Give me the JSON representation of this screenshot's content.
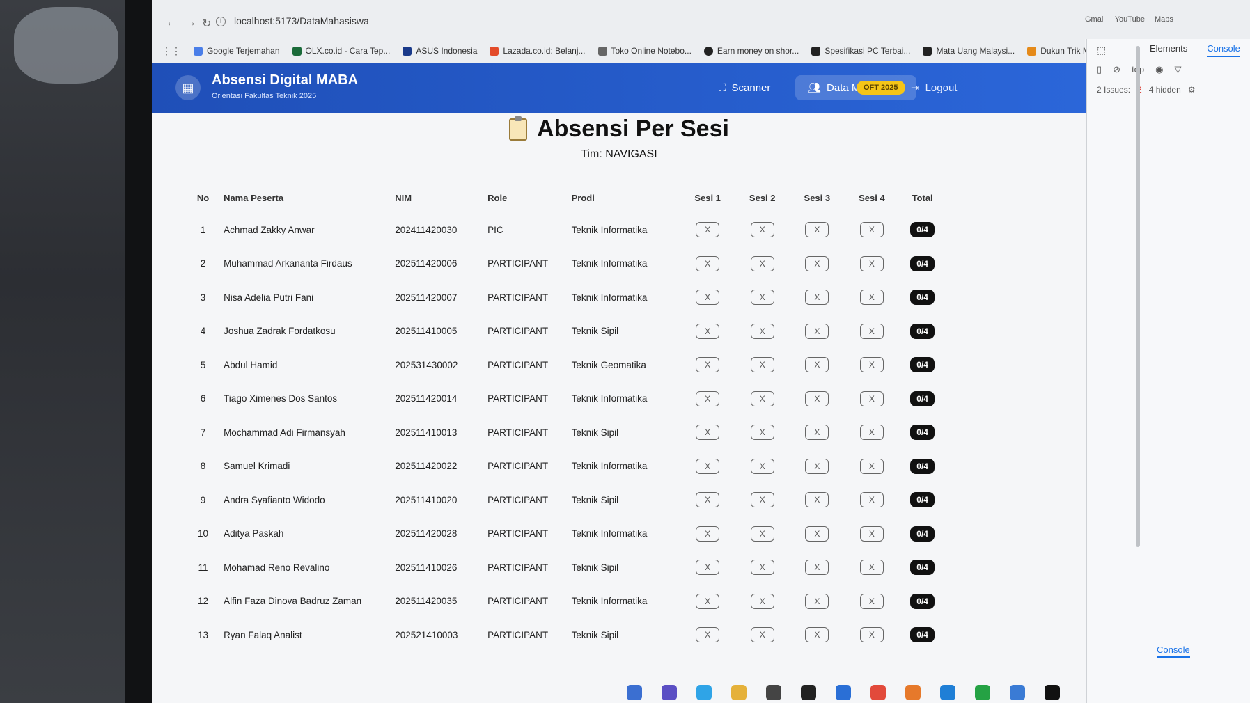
{
  "browser": {
    "url": "localhost:5173/DataMahasiswa",
    "bookmarks": [
      {
        "label": "Google Terjemahan",
        "color": "#4a7ee8"
      },
      {
        "label": "OLX.co.id - Cara Tep...",
        "color": "#1b6b3a"
      },
      {
        "label": "ASUS Indonesia",
        "color": "#1a3a8a"
      },
      {
        "label": "Lazada.co.id: Belanj...",
        "color": "#e34b2a"
      },
      {
        "label": "Toko Online Notebo...",
        "color": "#666666"
      },
      {
        "label": "Earn money on shor...",
        "color": "#222222"
      },
      {
        "label": "Spesifikasi PC Terbai...",
        "color": "#222222"
      },
      {
        "label": "Mata Uang Malaysi...",
        "color": "#222222"
      },
      {
        "label": "Dukun Trik Modern...",
        "color": "#e58a1a"
      }
    ],
    "bookmarks_right": [
      "Gmail",
      "YouTube",
      "Maps"
    ]
  },
  "devtools": {
    "tabs": [
      "Elements",
      "Console"
    ],
    "context": "top",
    "issues_label": "2 Issues:",
    "issues_count": "2",
    "hidden_label": "4 hidden",
    "bottom_tab": "Console"
  },
  "app": {
    "brand_title": "Absensi Digital MABA",
    "brand_subtitle": "Orientasi Fakultas Teknik 2025",
    "nav": {
      "scanner": "Scanner",
      "data_mahasiswa": "Data Mahasiswa",
      "badge": "OFT 2025",
      "logout": "Logout"
    },
    "page_title": "Absensi Per Sesi",
    "team_label": "Tim:",
    "team_name": "NAVIGASI",
    "columns": {
      "no": "No",
      "name": "Nama Peserta",
      "nim": "NIM",
      "role": "Role",
      "prodi": "Prodi",
      "s1": "Sesi 1",
      "s2": "Sesi 2",
      "s3": "Sesi 3",
      "s4": "Sesi 4",
      "total": "Total"
    },
    "mark": "X",
    "rows": [
      {
        "no": "1",
        "name": "Achmad Zakky Anwar",
        "nim": "202411420030",
        "role": "PIC",
        "prodi": "Teknik Informatika",
        "total": "0/4"
      },
      {
        "no": "2",
        "name": "Muhammad Arkananta Firdaus",
        "nim": "202511420006",
        "role": "PARTICIPANT",
        "prodi": "Teknik Informatika",
        "total": "0/4"
      },
      {
        "no": "3",
        "name": "Nisa Adelia Putri Fani",
        "nim": "202511420007",
        "role": "PARTICIPANT",
        "prodi": "Teknik Informatika",
        "total": "0/4"
      },
      {
        "no": "4",
        "name": "Joshua Zadrak Fordatkosu",
        "nim": "202511410005",
        "role": "PARTICIPANT",
        "prodi": "Teknik Sipil",
        "total": "0/4"
      },
      {
        "no": "5",
        "name": "Abdul Hamid",
        "nim": "202531430002",
        "role": "PARTICIPANT",
        "prodi": "Teknik Geomatika",
        "total": "0/4"
      },
      {
        "no": "6",
        "name": "Tiago Ximenes Dos Santos",
        "nim": "202511420014",
        "role": "PARTICIPANT",
        "prodi": "Teknik Informatika",
        "total": "0/4"
      },
      {
        "no": "7",
        "name": "Mochammad Adi Firmansyah",
        "nim": "202511410013",
        "role": "PARTICIPANT",
        "prodi": "Teknik Sipil",
        "total": "0/4"
      },
      {
        "no": "8",
        "name": "Samuel Krimadi",
        "nim": "202511420022",
        "role": "PARTICIPANT",
        "prodi": "Teknik Informatika",
        "total": "0/4"
      },
      {
        "no": "9",
        "name": "Andra Syafianto Widodo",
        "nim": "202511410020",
        "role": "PARTICIPANT",
        "prodi": "Teknik Sipil",
        "total": "0/4"
      },
      {
        "no": "10",
        "name": "Aditya Paskah",
        "nim": "202511420028",
        "role": "PARTICIPANT",
        "prodi": "Teknik Informatika",
        "total": "0/4"
      },
      {
        "no": "11",
        "name": "Mohamad Reno Revalino",
        "nim": "202511410026",
        "role": "PARTICIPANT",
        "prodi": "Teknik Sipil",
        "total": "0/4"
      },
      {
        "no": "12",
        "name": "Alfin Faza Dinova Badruz Zaman",
        "nim": "202511420035",
        "role": "PARTICIPANT",
        "prodi": "Teknik Informatika",
        "total": "0/4"
      },
      {
        "no": "13",
        "name": "Ryan Falaq Analist",
        "nim": "202521410003",
        "role": "PARTICIPANT",
        "prodi": "Teknik Sipil",
        "total": "0/4"
      }
    ]
  },
  "colors": {
    "header_blue": "#2b66d9",
    "badge_yellow": "#f5c518",
    "total_badge": "#111111"
  }
}
